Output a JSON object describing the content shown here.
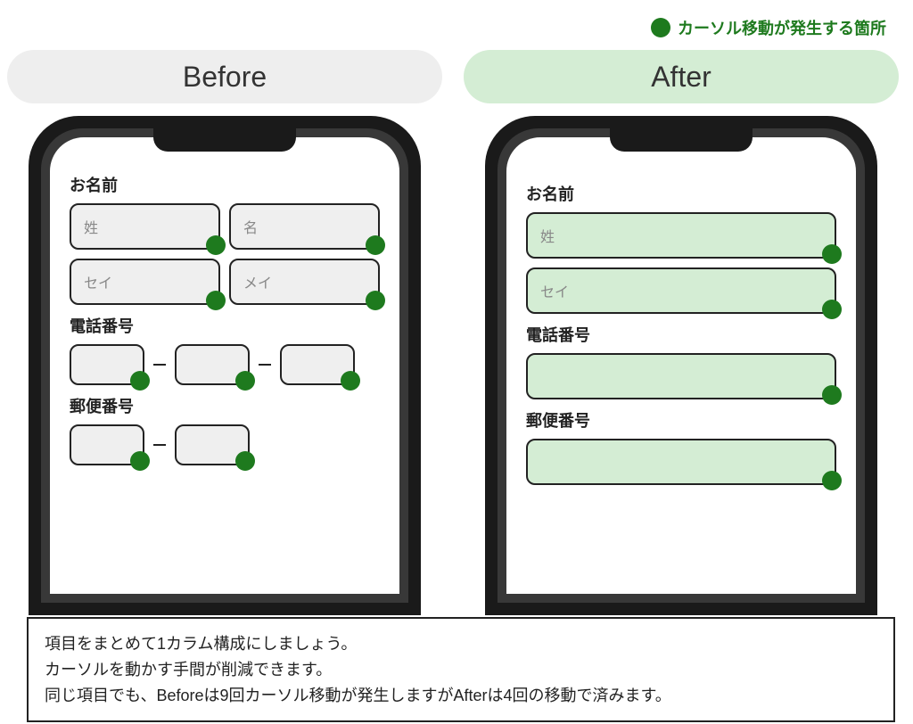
{
  "legend": {
    "text": "カーソル移動が発生する箇所"
  },
  "headers": {
    "before": "Before",
    "after": "After"
  },
  "labels": {
    "name": "お名前",
    "phone": "電話番号",
    "postal": "郵便番号"
  },
  "placeholders": {
    "sei_kanji": "姓",
    "mei_kanji": "名",
    "sei_kana": "セイ",
    "mei_kana": "メイ"
  },
  "caption": {
    "line1": "項目をまとめて1カラム構成にしましょう。",
    "line2": "カーソルを動かす手間が削減できます。",
    "line3": "同じ項目でも、Beforeは9回カーソル移動が発生しますがAfterは4回の移動で済みます。"
  },
  "cursor_counts": {
    "before": 9,
    "after": 4
  },
  "colors": {
    "accent": "#1e7a1e",
    "after_bg": "#d4edd4",
    "before_bg": "#eeeeee"
  }
}
